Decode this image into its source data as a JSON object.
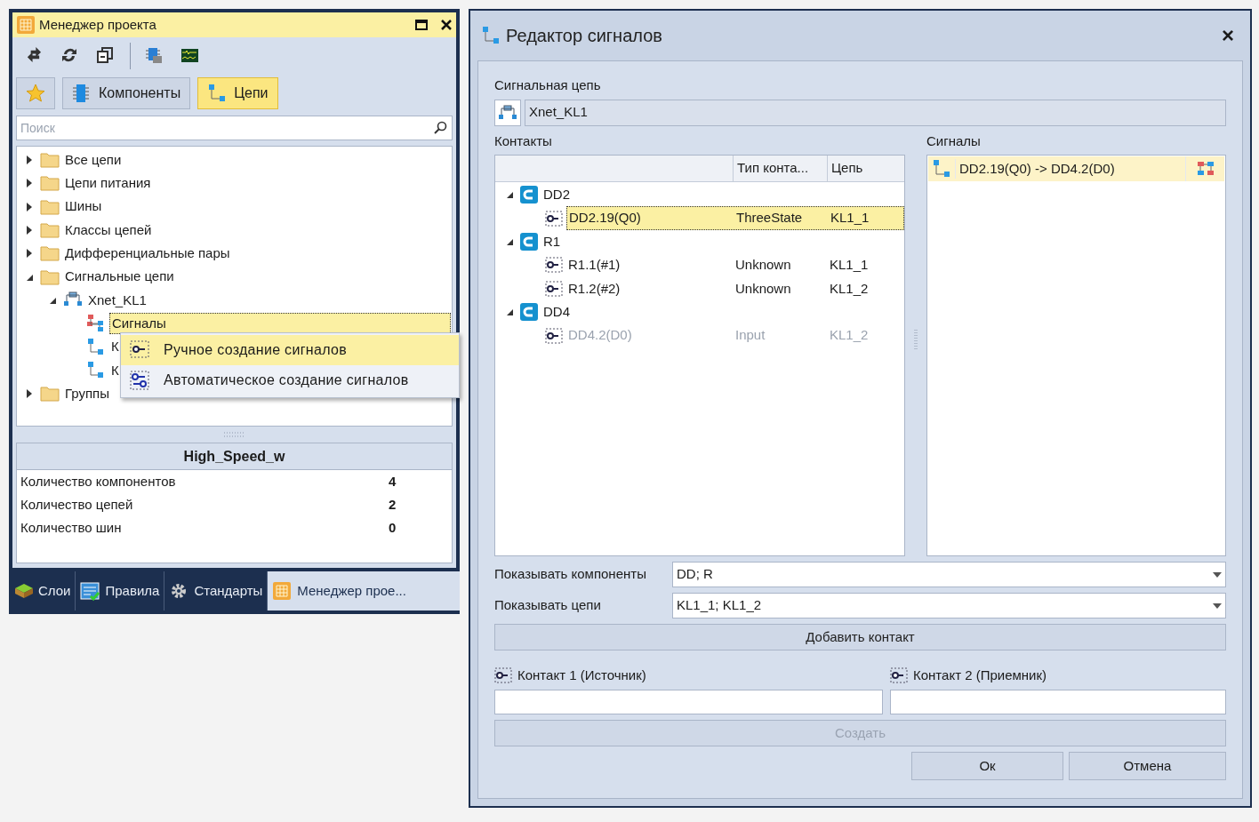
{
  "project_manager": {
    "title": "Менеджер проекта",
    "toolbar": [
      {
        "kind": "swap"
      },
      {
        "kind": "refresh"
      },
      {
        "kind": "windows"
      },
      {
        "kind": "chip"
      },
      {
        "kind": "scope"
      }
    ],
    "categories": [
      {
        "kind": "favorites",
        "selected": false
      },
      {
        "kind": "components",
        "label": "Компоненты",
        "selected": false
      },
      {
        "kind": "nets",
        "label": "Цепи",
        "selected": true
      }
    ],
    "search": {
      "placeholder": "Поиск"
    },
    "tree": [
      {
        "label": "Все цепи",
        "kind": "folder",
        "expanded": false,
        "selected": false
      },
      {
        "label": "Цепи питания",
        "kind": "folder",
        "expanded": false,
        "selected": false
      },
      {
        "label": "Шины",
        "kind": "folder",
        "expanded": false,
        "selected": false
      },
      {
        "label": "Классы цепей",
        "kind": "folder",
        "expanded": false,
        "selected": false
      },
      {
        "label": "Дифференциальные пары",
        "kind": "folder",
        "expanded": false,
        "selected": false
      },
      {
        "label": "Сигнальные цепи",
        "kind": "folder",
        "expanded": true,
        "selected": false,
        "children": [
          {
            "label": "Xnet_KL1",
            "kind": "xnet",
            "expanded": true,
            "selected": false,
            "children": [
              {
                "label": "Сигналы",
                "kind": "signals",
                "selected": true
              },
              {
                "label": "К",
                "kind": "chain",
                "selected": false
              },
              {
                "label": "К",
                "kind": "chain",
                "selected": false
              }
            ]
          }
        ]
      },
      {
        "label": "Группы",
        "kind": "folder",
        "expanded": false,
        "selected": false
      }
    ],
    "context_menu": [
      {
        "label": "Ручное создание сигналов",
        "kind": "manual",
        "selected": true
      },
      {
        "label": "Автоматическое создание сигналов",
        "kind": "auto",
        "selected": false
      }
    ],
    "info": {
      "title": "High_Speed_w",
      "rows": [
        {
          "label": "Количество компонентов",
          "value": "4"
        },
        {
          "label": "Количество цепей",
          "value": "2"
        },
        {
          "label": "Количество шин",
          "value": "0"
        }
      ]
    },
    "bottom_tabs": [
      {
        "kind": "layers",
        "label": "Слои",
        "selected": false
      },
      {
        "kind": "rules",
        "label": "Правила",
        "selected": false
      },
      {
        "kind": "standards",
        "label": "Стандарты",
        "selected": false
      },
      {
        "kind": "project",
        "label": "Менеджер прое...",
        "selected": true
      }
    ]
  },
  "signal_editor": {
    "title": "Редактор сигналов",
    "close": "×",
    "signal_net": {
      "label": "Сигнальная цепь",
      "value": "Xnet_KL1"
    },
    "contacts": {
      "label": "Контакты",
      "columns": [
        "Тип конта...",
        "Цепь"
      ],
      "groups": [
        {
          "name": "DD2",
          "expanded": true,
          "children": [
            {
              "name": "DD2.19(Q0)",
              "type": "ThreeState",
              "net": "KL1_1",
              "selected": true,
              "disabled": false
            }
          ]
        },
        {
          "name": "R1",
          "expanded": true,
          "children": [
            {
              "name": "R1.1(#1)",
              "type": "Unknown",
              "net": "KL1_1",
              "selected": false,
              "disabled": false
            },
            {
              "name": "R1.2(#2)",
              "type": "Unknown",
              "net": "KL1_2",
              "selected": false,
              "disabled": false
            }
          ]
        },
        {
          "name": "DD4",
          "expanded": true,
          "children": [
            {
              "name": "DD4.2(D0)",
              "type": "Input",
              "net": "KL1_2",
              "selected": false,
              "disabled": true
            }
          ]
        }
      ]
    },
    "signals": {
      "label": "Сигналы",
      "items": [
        {
          "label": "DD2.19(Q0) -> DD4.2(D0)",
          "selected": true
        }
      ]
    },
    "show_components": {
      "label": "Показывать компоненты",
      "value": "DD; R"
    },
    "show_nets": {
      "label": "Показывать цепи",
      "value": "KL1_1; KL1_2"
    },
    "add_contact": {
      "label": "Добавить контакт",
      "disabled": false
    },
    "contact1": {
      "label": "Контакт 1 (Источник)"
    },
    "contact2": {
      "label": "Контакт 2 (Приемник)"
    },
    "create": {
      "label": "Создать",
      "disabled": true
    },
    "ok": "Ок",
    "cancel": "Отмена"
  }
}
